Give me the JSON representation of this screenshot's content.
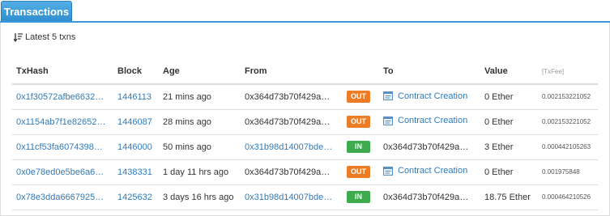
{
  "tab": {
    "label": "Transactions"
  },
  "summary": {
    "text": "Latest 5 txns"
  },
  "columns": {
    "txhash": "TxHash",
    "block": "Block",
    "age": "Age",
    "from": "From",
    "to": "To",
    "value": "Value",
    "txfee": "[TxFee]"
  },
  "rows": [
    {
      "txhash": "0x1f30572afbe6632…",
      "block": "1446113",
      "age": "21 mins ago",
      "from": "0x364d73b70f429a…",
      "direction": "OUT",
      "to": "Contract Creation",
      "value": "0 Ether",
      "fee": "0.002153221052"
    },
    {
      "txhash": "0x1154ab7f1e82652…",
      "block": "1446087",
      "age": "28 mins ago",
      "from": "0x364d73b70f429a…",
      "direction": "OUT",
      "to": "Contract Creation",
      "value": "0 Ether",
      "fee": "0.002153221052"
    },
    {
      "txhash": "0x11cf53fa6074398…",
      "block": "1446000",
      "age": "50 mins ago",
      "from": "0x31b98d14007bde…",
      "direction": "IN",
      "to": "0x364d73b70f429a…",
      "value": "3 Ether",
      "fee": "0.000442105263"
    },
    {
      "txhash": "0x0e78ed0e5be6a6…",
      "block": "1438331",
      "age": "1 day 11 hrs ago",
      "from": "0x364d73b70f429a…",
      "direction": "OUT",
      "to": "Contract Creation",
      "value": "0 Ether",
      "fee": "0.001975848"
    },
    {
      "txhash": "0x78e3dda6667925…",
      "block": "1425632",
      "age": "3 days 16 hrs ago",
      "from": "0x31b98d14007bde…",
      "direction": "IN",
      "to": "0x364d73b70f429a…",
      "value": "18.75 Ether",
      "fee": "0.000464210526"
    }
  ],
  "colors": {
    "link": "#337ab7",
    "out_badge": "#ec7d26",
    "in_badge": "#3eac4e",
    "tab": "#3b97d9"
  }
}
